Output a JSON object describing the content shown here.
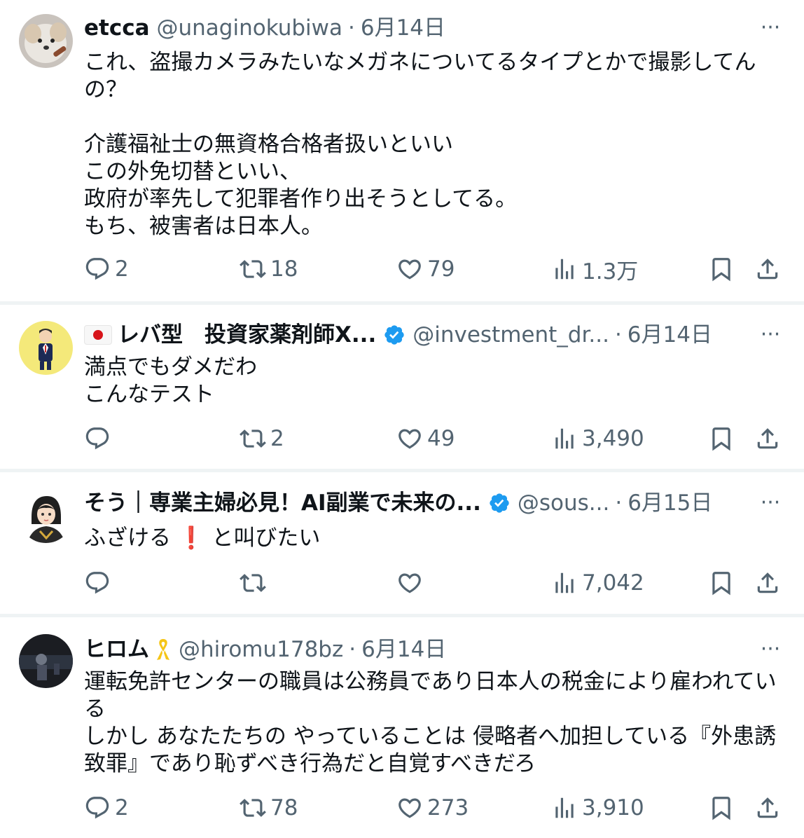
{
  "tweets": [
    {
      "name": "etcca",
      "handle": "@unaginokubiwa",
      "date": "6月14日",
      "text": "これ、盗撮カメラみたいなメガネについてるタイプとかで撮影してんの？\n\n介護福祉士の無資格合格者扱いといい\nこの外免切替といい、\n政府が率先して犯罪者作り出そうとしてる。\nもち、被害者は日本人。",
      "replies": "2",
      "retweets": "18",
      "likes": "79",
      "views": "1.3万"
    },
    {
      "name": "レバ型　投資家薬剤師X...",
      "handle": "@investment_dr...",
      "date": "6月14日",
      "text": "満点でもダメだわ\nこんなテスト",
      "replies": "",
      "retweets": "2",
      "likes": "49",
      "views": "3,490"
    },
    {
      "name": "そう｜専業主婦必見！AI副業で未来の...",
      "handle": "@sous...",
      "date": "6月15日",
      "text_a": "ふざける",
      "text_b": "と叫びたい",
      "exclaim": "❗",
      "replies": "",
      "retweets": "",
      "likes": "",
      "views": "7,042"
    },
    {
      "name": "ヒロム",
      "handle": "@hiromu178bz",
      "date": "6月14日",
      "text": "運転免許センターの職員は公務員であり日本人の税金により雇われている\nしかし あなたたちの やっていることは 侵略者へ加担している『外患誘致罪』であり恥ずべき行為だと自覚すべきだろ",
      "replies": "2",
      "retweets": "78",
      "likes": "273",
      "views": "3,910"
    }
  ],
  "separator": "·",
  "more_glyph": "···",
  "colors": {
    "secondary": "#536471",
    "divider": "#eff3f4",
    "verified": "#1d9bf0"
  }
}
